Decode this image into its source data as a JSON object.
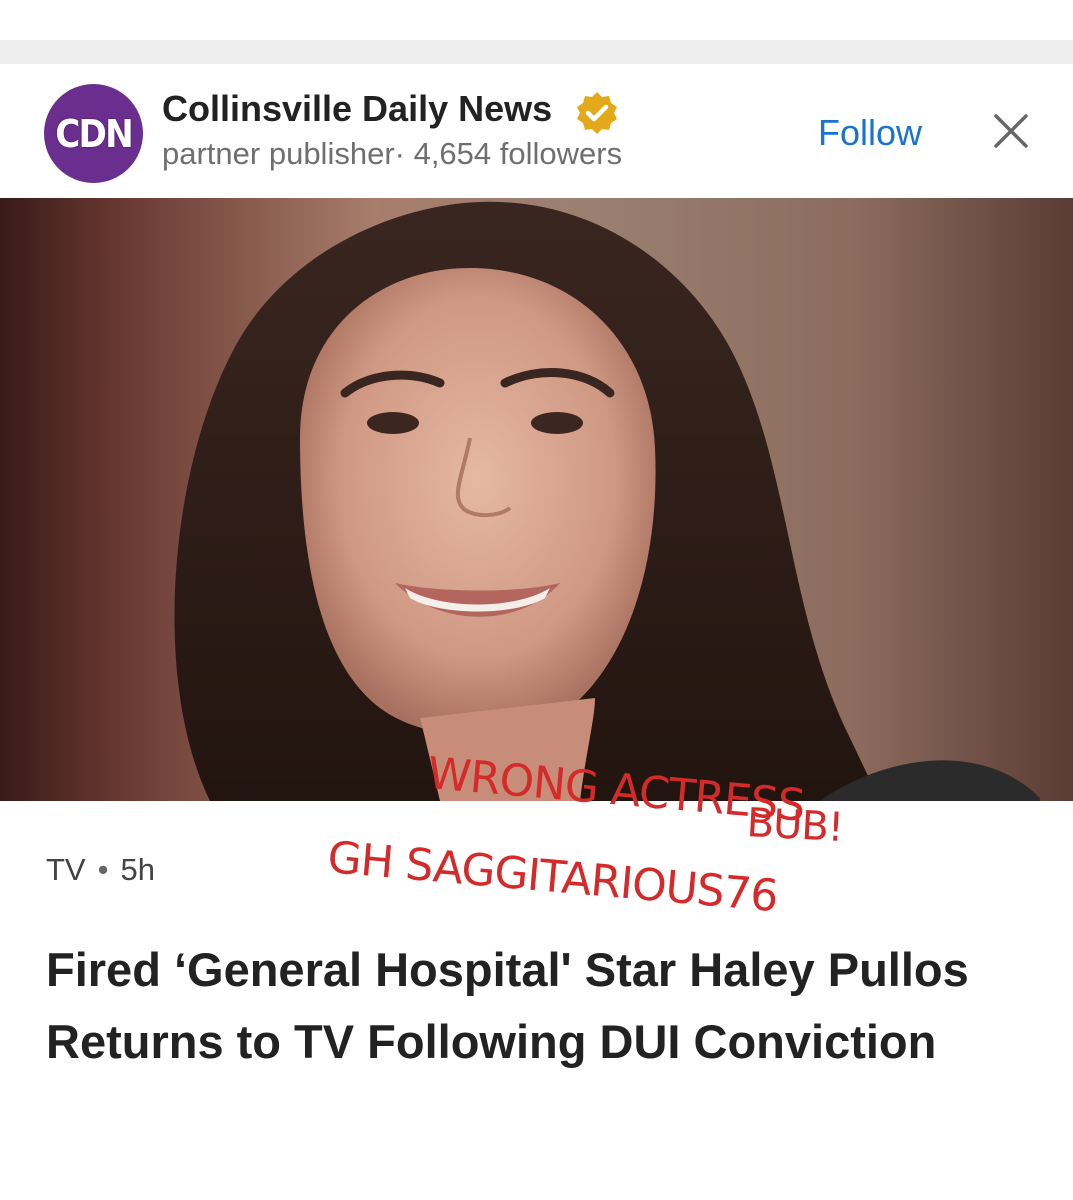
{
  "publisher": {
    "logo_text": "CDN",
    "name": "Collinsville Daily News",
    "meta": "partner publisher· 4,654 followers",
    "follow_label": "Follow",
    "brand_color": "#6a2f8e",
    "follow_color": "#1a73d1",
    "verified_color": "#e3a91b"
  },
  "icons": {
    "verified": "verified-badge-icon",
    "close": "close-icon"
  },
  "article": {
    "category": "TV",
    "separator": "•",
    "age": "5h",
    "headline": "Fired ‘General Hospital' Star Haley Pullos Returns to TV Following DUI Conviction"
  },
  "overlay_text": {
    "line1": "WRONG ACTRESS",
    "line2": "BUB!",
    "line3": "GH SAGGITARIOUS76",
    "color": "#d42a2a"
  }
}
